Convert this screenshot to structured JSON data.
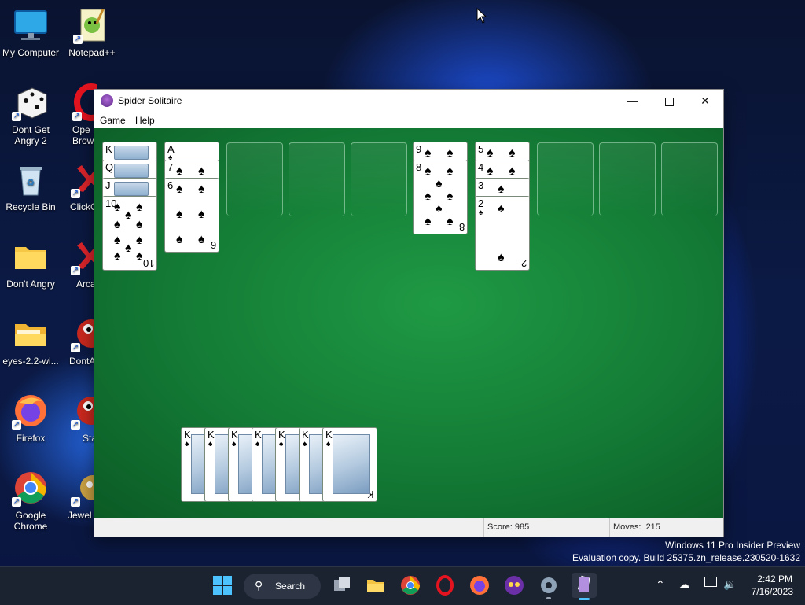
{
  "desktop": {
    "icons": [
      {
        "label": "My Computer"
      },
      {
        "label": "Notepad++"
      },
      {
        "label": "Dont Get Angry 2"
      },
      {
        "label": "Opera Browser",
        "visible_text": "Ope Brow"
      },
      {
        "label": "Recycle Bin"
      },
      {
        "label": "ClickC"
      },
      {
        "label": "Don't Angry"
      },
      {
        "label": "Arca"
      },
      {
        "label": "eyes-2.2-wi..."
      },
      {
        "label": "DontA"
      },
      {
        "label": "Firefox"
      },
      {
        "label": "Sta"
      },
      {
        "label": "Google Chrome"
      },
      {
        "label": "Jewel"
      }
    ],
    "watermark_line1": "Windows 11 Pro Insider Preview",
    "watermark_line2": "Evaluation copy. Build 25375.zn_release.230520-1632"
  },
  "window": {
    "title": "Spider Solitaire",
    "menu": [
      "Game",
      "Help"
    ],
    "status": {
      "score": "Score: 985",
      "moves": "Moves:  215"
    }
  },
  "tableau": {
    "col1": [
      "K",
      "Q",
      "J",
      "10"
    ],
    "col2": [
      "A",
      "7",
      "6"
    ],
    "col6": [
      "9",
      "8"
    ],
    "col7": [
      "5",
      "4",
      "3",
      "2"
    ],
    "completed_kings": [
      "K",
      "K",
      "K",
      "K",
      "K",
      "K",
      "K"
    ]
  },
  "taskbar": {
    "search_label": "Search",
    "time": "2:42 PM",
    "date": "7/16/2023"
  },
  "colors": {
    "felt": "#137a35",
    "taskbar": "#1c2330"
  }
}
